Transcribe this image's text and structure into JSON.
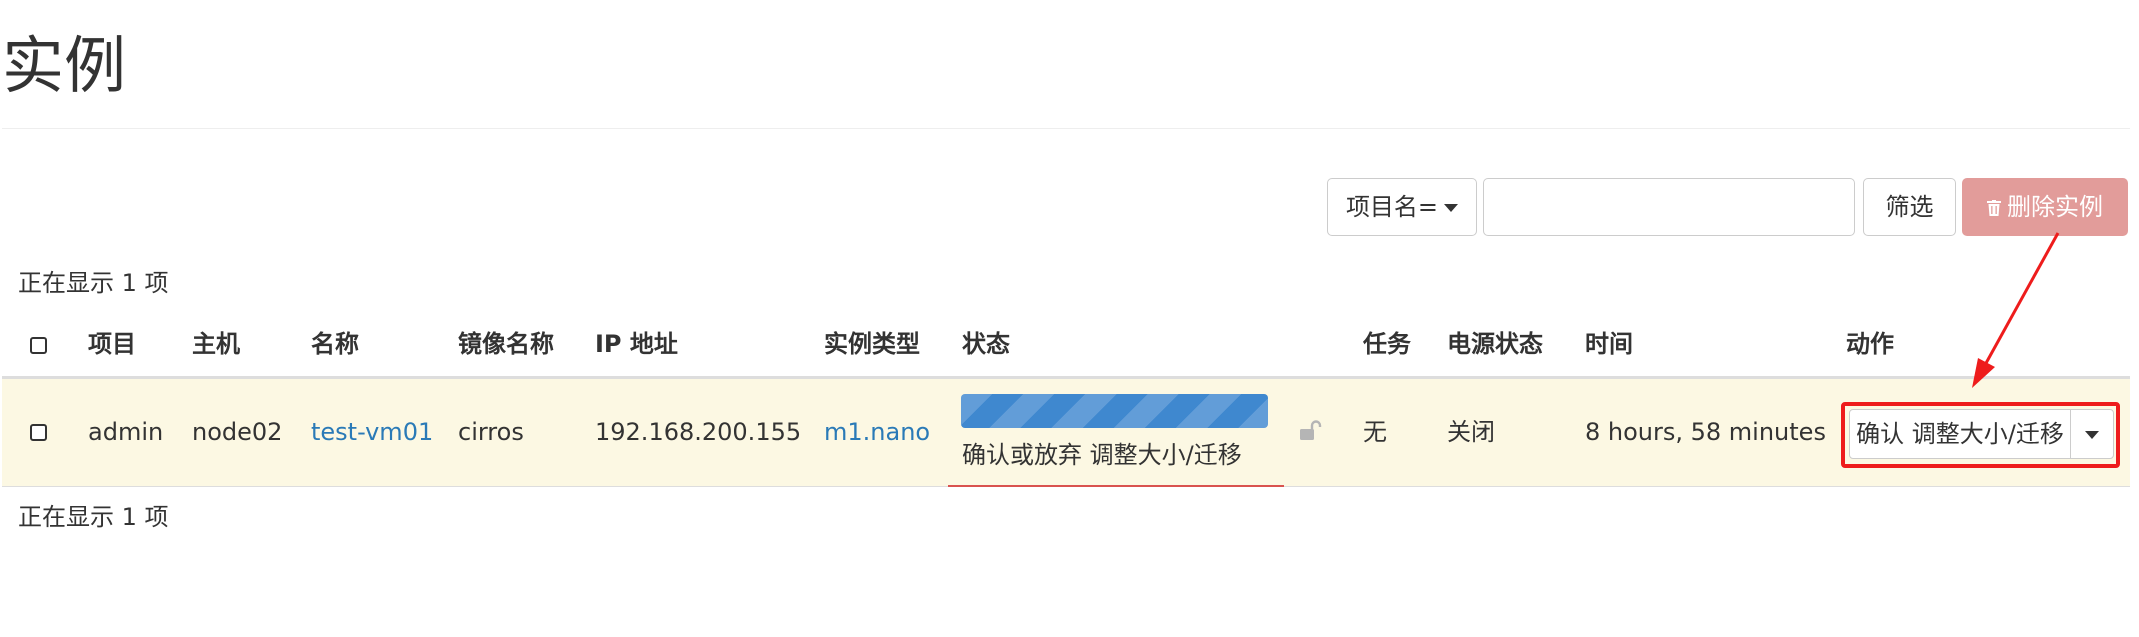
{
  "page": {
    "title": "实例"
  },
  "toolbar": {
    "filter_field": "项目名=",
    "search_value": "",
    "filter_button": "筛选",
    "delete_button": "删除实例"
  },
  "table": {
    "count_text": "正在显示 1 项",
    "headers": [
      "项目",
      "主机",
      "名称",
      "镜像名称",
      "IP 地址",
      "实例类型",
      "状态",
      "任务",
      "电源状态",
      "时间",
      "动作"
    ],
    "rows": [
      {
        "project": "admin",
        "host": "node02",
        "name": "test-vm01",
        "image": "cirros",
        "ip": "192.168.200.155",
        "flavor": "m1.nano",
        "status": "确认或放弃 调整大小/迁移",
        "status_progress_percent": 100,
        "task": "无",
        "power_state": "关闭",
        "time": "8 hours, 58 minutes",
        "action": "确认 调整大小/迁移"
      }
    ]
  },
  "icons": {
    "filter_caret": "caret-down-icon",
    "delete": "trash-icon",
    "lock": "unlock-icon",
    "action_caret": "caret-down-icon"
  },
  "colors": {
    "link": "#2a7ab7",
    "danger": "#e29c9a",
    "row_highlight": "#fcf8e3",
    "progress": "#3f88cf",
    "annotation": "#ee1c1c"
  }
}
